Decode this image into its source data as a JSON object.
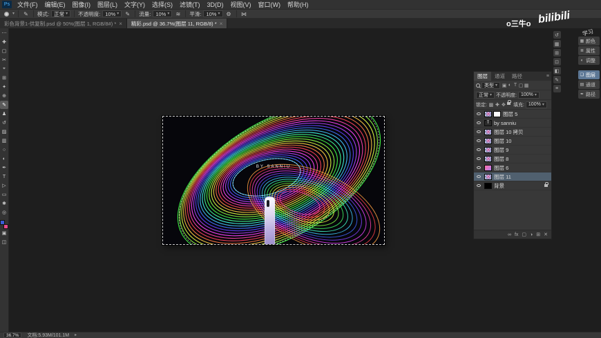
{
  "app": {
    "logo": "Ps"
  },
  "ui": {
    "caret": "▾",
    "close": "×",
    "menu_icon": "≡",
    "status_chevron": "▸"
  },
  "menu": {
    "items": [
      "文件(F)",
      "编辑(E)",
      "图像(I)",
      "图层(L)",
      "文字(Y)",
      "选择(S)",
      "滤镜(T)",
      "3D(D)",
      "视图(V)",
      "窗口(W)",
      "帮助(H)"
    ]
  },
  "options": {
    "mode_label": "模式:",
    "mode_value": "正常",
    "opacity_label": "不透明度:",
    "opacity_value": "10%",
    "flow_label": "流量:",
    "flow_value": "10%",
    "smooth_label": "平滑:",
    "smooth_value": "10%",
    "icons": {
      "pressure": "✎",
      "airbrush": "≋",
      "gear": "⚙",
      "symmetry": "⋈"
    }
  },
  "tabs": [
    {
      "label": "彩色背景1-供复制.psd @ 50%(图层 1, RGB/8#) *",
      "active": false
    },
    {
      "label": "精彩.psd @ 36.7%(图层 11, RGB/8) *",
      "active": true
    }
  ],
  "toolbar": {
    "foreground_color": "#3b5bd6",
    "background_color": "#e84a8a",
    "tools": [
      {
        "name": "edit-toolbar-icon",
        "glyph": "⋯"
      },
      {
        "name": "move-tool",
        "glyph": "✚"
      },
      {
        "name": "marquee-tool",
        "glyph": "▢"
      },
      {
        "name": "lasso-tool",
        "glyph": "✂"
      },
      {
        "name": "quick-select-tool",
        "glyph": "⌖"
      },
      {
        "name": "crop-tool",
        "glyph": "⊞"
      },
      {
        "name": "eyedropper-tool",
        "glyph": "✦"
      },
      {
        "name": "healing-brush-tool",
        "glyph": "⊕"
      },
      {
        "name": "brush-tool",
        "glyph": "✎",
        "active": true
      },
      {
        "name": "clone-stamp-tool",
        "glyph": "♟"
      },
      {
        "name": "history-brush-tool",
        "glyph": "↺"
      },
      {
        "name": "eraser-tool",
        "glyph": "▨"
      },
      {
        "name": "gradient-tool",
        "glyph": "▥"
      },
      {
        "name": "blur-tool",
        "glyph": "○"
      },
      {
        "name": "dodge-tool",
        "glyph": "◐"
      },
      {
        "name": "pen-tool",
        "glyph": "✒"
      },
      {
        "name": "type-tool",
        "glyph": "T"
      },
      {
        "name": "path-select-tool",
        "glyph": "▷"
      },
      {
        "name": "shape-tool",
        "glyph": "▭"
      },
      {
        "name": "hand-tool",
        "glyph": "✱"
      },
      {
        "name": "zoom-tool",
        "glyph": "◎"
      }
    ],
    "bottom_tools": [
      {
        "name": "quick-mask-icon",
        "glyph": "▣"
      },
      {
        "name": "screen-mode-icon",
        "glyph": "◫"
      }
    ]
  },
  "canvas": {
    "artwork_text": "BY SANNIU"
  },
  "watermark": {
    "name1": "o三牛o",
    "name2": "bilibili",
    "name3": "学习"
  },
  "right_strip": {
    "icons": [
      {
        "name": "history-panel-icon",
        "glyph": "↺"
      },
      {
        "name": "swatches-panel-icon",
        "glyph": "▦"
      },
      {
        "name": "libraries-panel-icon",
        "glyph": "⊞"
      },
      {
        "name": "info-panel-icon",
        "glyph": "⊡"
      },
      {
        "name": "navigator-panel-icon",
        "glyph": "◧"
      },
      {
        "name": "brush-settings-panel-icon",
        "glyph": "✎"
      },
      {
        "name": "character-panel-icon",
        "glyph": "≡"
      }
    ]
  },
  "right_dock": {
    "groups": [
      {
        "items": [
          {
            "name": "color-panel",
            "label": "颜色",
            "glyph": "▦"
          },
          {
            "name": "properties-panel",
            "label": "属性",
            "glyph": "≣"
          },
          {
            "name": "adjustments-panel",
            "label": "调整",
            "glyph": "◐"
          }
        ]
      },
      {
        "items": [
          {
            "name": "layers-panel",
            "label": "图层",
            "glyph": "❏",
            "active": true
          },
          {
            "name": "channels-panel",
            "label": "通道",
            "glyph": "▤"
          },
          {
            "name": "paths-panel",
            "label": "路径",
            "glyph": "✒"
          }
        ]
      }
    ]
  },
  "layers_panel": {
    "tabs": [
      {
        "label": "图层",
        "active": true
      },
      {
        "label": "通道"
      },
      {
        "label": "路径"
      }
    ],
    "filter_label": "类型",
    "filter_icons": [
      {
        "name": "filter-pixel-icon",
        "glyph": "▣"
      },
      {
        "name": "filter-adjustment-icon",
        "glyph": "◐"
      },
      {
        "name": "filter-type-icon",
        "glyph": "T"
      },
      {
        "name": "filter-shape-icon",
        "glyph": "▢"
      },
      {
        "name": "filter-smart-object-icon",
        "glyph": "▦"
      }
    ],
    "blend_mode": "正常",
    "opacity_label": "不透明度:",
    "opacity_value": "100%",
    "lock_label": "锁定:",
    "lock_icons": [
      {
        "name": "lock-transparency-icon",
        "glyph": "▩"
      },
      {
        "name": "lock-pixels-icon",
        "glyph": "✚"
      },
      {
        "name": "lock-position-icon",
        "glyph": "✥"
      },
      {
        "name": "lock-all-icon",
        "glyph": "LOCK"
      }
    ],
    "fill_label": "填充:",
    "fill_value": "100%",
    "text_thumb_glyph": "T",
    "layers": [
      {
        "name": "图层 5",
        "thumbs": [
          "checker",
          "white"
        ]
      },
      {
        "name": "by sanniu",
        "thumbs": [
          "text"
        ]
      },
      {
        "name": "图层 10 拷贝",
        "thumbs": [
          "checker"
        ]
      },
      {
        "name": "图层 10",
        "thumbs": [
          "checker"
        ]
      },
      {
        "name": "图层 9",
        "thumbs": [
          "checker"
        ]
      },
      {
        "name": "图层 8",
        "thumbs": [
          "checker"
        ]
      },
      {
        "name": "图层 6",
        "thumbs": [
          "pink"
        ]
      },
      {
        "name": "图层 11",
        "thumbs": [
          "checker"
        ],
        "selected": true
      },
      {
        "name": "背景",
        "thumbs": [
          "black"
        ],
        "locked": true
      }
    ],
    "bottom_icons": [
      {
        "name": "link-layers-icon",
        "glyph": "∞"
      },
      {
        "name": "layer-style-icon",
        "glyph": "fx"
      },
      {
        "name": "layer-mask-icon",
        "glyph": "▢"
      },
      {
        "name": "adjustment-layer-icon",
        "glyph": "◑"
      },
      {
        "name": "new-layer-icon",
        "glyph": "⊞"
      },
      {
        "name": "delete-layer-icon",
        "glyph": "✕"
      }
    ]
  },
  "status": {
    "zoom": "36.7%",
    "doc_info": "文档:5.93M/101.1M"
  }
}
